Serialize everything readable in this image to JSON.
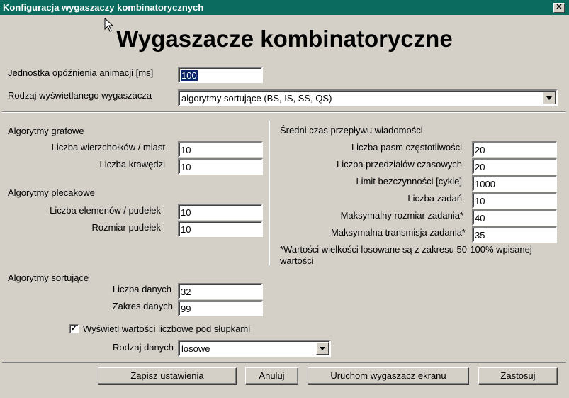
{
  "window": {
    "title": "Konfiguracja wygaszaczy kombinatorycznych",
    "close_glyph": "✕"
  },
  "heading": "Wygaszacze kombinatoryczne",
  "general": {
    "delay_label": "Jednostka opóźnienia animacji [ms]",
    "delay_value": "100",
    "type_label": "Rodzaj wyświetlanego wygaszacza",
    "type_value": "algorytmy sortujące (BS, IS, SS, QS)"
  },
  "graph": {
    "title": "Algorytmy grafowe",
    "vertices_label": "Liczba wierzchołków / miast",
    "vertices_value": "10",
    "edges_label": "Liczba krawędzi",
    "edges_value": "10"
  },
  "knapsack": {
    "title": "Algorytmy plecakowe",
    "elements_label": "Liczba elemenów / pudełek",
    "elements_value": "10",
    "box_size_label": "Rozmiar pudełek",
    "box_size_value": "10"
  },
  "sorting": {
    "title": "Algorytmy sortujące",
    "count_label": "Liczba danych",
    "count_value": "32",
    "range_label": "Zakres danych",
    "range_value": "99",
    "show_values_label": "Wyświetl wartości liczbowe pod słupkami",
    "show_values_checked": true,
    "check_glyph": "✓",
    "data_type_label": "Rodzaj danych",
    "data_type_value": "losowe"
  },
  "messages": {
    "title": "Średni czas przepływu wiadomości",
    "bands_label": "Liczba pasm częstotliwości",
    "bands_value": "20",
    "slots_label": "Liczba przedziałów czasowych",
    "slots_value": "20",
    "idle_label": "Limit bezczynności [cykle]",
    "idle_value": "1000",
    "tasks_label": "Liczba zadań",
    "tasks_value": "10",
    "max_size_label": "Maksymalny rozmiar zadania*",
    "max_size_value": "40",
    "max_tx_label": "Maksymalna transmisja zadania*",
    "max_tx_value": "35",
    "note_line1": "*Wartości wielkości losowane są z zakresu 50-100% wpisanej",
    "note_line2": "wartości"
  },
  "buttons": {
    "save": "Zapisz ustawienia",
    "cancel": "Anuluj",
    "run": "Uruchom wygaszacz ekranu",
    "apply": "Zastosuj"
  }
}
